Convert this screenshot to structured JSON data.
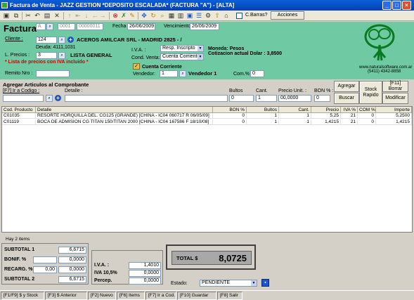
{
  "window": {
    "title": "Factura de Venta - JAZZ GESTION *DEPOSITO ESCALADA* (FACTURA \"A\") - [ALTA]"
  },
  "toolbar": {
    "cbarras_label": "C.Barras?",
    "acciones_label": "Acciones"
  },
  "header": {
    "factura_label": "Factura",
    "tipo": "A",
    "punto_venta": "0001",
    "numero": "00000011",
    "fecha_label": "Fecha :",
    "fecha": "26/06/2009",
    "vencimiento_label": "Vencimiento :",
    "vencimiento": "26/06/2009",
    "cliente_label": "Cliente :",
    "cliente_codigo": "124",
    "cliente_nombre": "ACEROS AMILCAR SRL - MADRID 2825 - /",
    "deuda": "Deuda: 4111,1031",
    "lprecios_label": "L. Precios :",
    "lprecios_value": "3",
    "lista_nombre": "LISTA GENERAL",
    "lista_nota": "* Lista de precios con IVA incluido *",
    "iva_label": "I.V.A. :",
    "iva_value": "Resp. Inscripto",
    "cond_venta_label": "Cond. Venta:",
    "cond_venta_value": "Cuenta Corriente",
    "moneda": "Moneda: Pesos",
    "cotizacion": "Cotizacion actual Dolar : 3,8500",
    "cuenta_corriente_label": "Cuenta Corriente",
    "vendedor_label": "Vendedor:",
    "vendedor_codigo": "1",
    "vendedor_nombre": "Vendedor 1",
    "com_label": "Com.% :",
    "com_value": "0",
    "remito_label": "Remito Nro :",
    "remito_value": "",
    "web": "www.naturalsoftware.com.ar",
    "telefono": "(5411) 4342-8858"
  },
  "agregar": {
    "title": "Agregar Articulos al Comprobante",
    "codigo_label": "[F7] Ir a Codigo :",
    "detalle_label": "Detalle :",
    "bultos_label": "Bultos",
    "cant_label": "Cant.",
    "precio_label": "Precio Unit. :",
    "bon_label": "BON % :",
    "bultos_value": "0",
    "cant_value": "1",
    "precio_value": "00,0000",
    "bon_value": "0",
    "agregar_btn": "Agregar",
    "buscar_btn": "Buscar",
    "stock_btn": "Stock Rapido",
    "borrar_btn": "[F11] Borrar",
    "modificar_btn": "Modificar"
  },
  "grid": {
    "columns": [
      "Cod. Producto",
      "Detalle",
      "BON %",
      "Bultos",
      "Cant.",
      "Precio",
      "IVA %",
      "COM %",
      "Importe"
    ],
    "rows": [
      [
        "C01035",
        "RESORTE HORQUILLA DEL. CG125 (GRANDE) [CHINA - IC04 060717 R 06/05/09]",
        "0",
        "1",
        "1",
        "5,25",
        "21",
        "0",
        "5,2500"
      ],
      [
        "C01119",
        "BOCA DE ADMISION CG TITAN 150/TITAN 2000 [CHINA - IC04 167586 F 18/10/08]",
        "0",
        "1",
        "1",
        "1,4215",
        "21",
        "0",
        "1,4215"
      ]
    ],
    "count_text": "Hay 2 items"
  },
  "totals": {
    "subtotal1_label": "SUBTOTAL 1",
    "subtotal1": "6,6715",
    "bonif_label": "BONIF. %",
    "bonif_pct": "",
    "bonif": "0,0000",
    "recarg_label": "RECARG. %",
    "recarg_pct": "0,00",
    "recarg": "0,0000",
    "subtotal2_label": "SUBTOTAL 2",
    "subtotal2": "6,6715",
    "iva_label": "I.V.A. :",
    "iva": "1,4010",
    "iva105_label": "IVA 10,5%",
    "iva105": "0,0000",
    "percep_label": "Percep.",
    "percep": "0,0000",
    "total_label": "TOTAL $",
    "total": "8,0725",
    "estado_label": "Estado:",
    "estado_value": "PENDIENTE"
  },
  "statusbar": [
    "[F1/F9] $ y Stock",
    "[F3] $ Anterior",
    "[F2] Nuevo",
    "[F6] Items",
    "[F7] Ir a Cod.",
    "[F10] Guardar",
    "[F8] Salir"
  ],
  "colors": {
    "header_bg": "#6fc9a3",
    "titlebar": "#0a5fd8",
    "accent_red": "#cc0000"
  }
}
